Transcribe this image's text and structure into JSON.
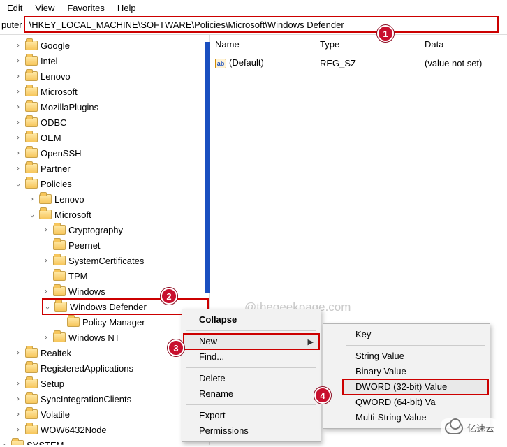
{
  "menu": {
    "edit": "Edit",
    "view": "View",
    "favorites": "Favorites",
    "help": "Help"
  },
  "address": {
    "prefix": "puter",
    "path": "\\HKEY_LOCAL_MACHINE\\SOFTWARE\\Policies\\Microsoft\\Windows Defender"
  },
  "columns": {
    "name": "Name",
    "type": "Type",
    "data": "Data"
  },
  "values": [
    {
      "name": "(Default)",
      "type": "REG_SZ",
      "data": "(value not set)"
    }
  ],
  "tree": {
    "google": "Google",
    "intel": "Intel",
    "lenovo": "Lenovo",
    "microsoft": "Microsoft",
    "mozilla": "MozillaPlugins",
    "odbc": "ODBC",
    "oem": "OEM",
    "openssh": "OpenSSH",
    "partner": "Partner",
    "policies": "Policies",
    "p_lenovo": "Lenovo",
    "p_microsoft": "Microsoft",
    "crypto": "Cryptography",
    "peernet": "Peernet",
    "syscert": "SystemCertificates",
    "tpm": "TPM",
    "windows": "Windows",
    "wdef": "Windows Defender",
    "polmgr": "Policy Manager",
    "winnt": "Windows NT",
    "realtek": "Realtek",
    "regapp": "RegisteredApplications",
    "setup": "Setup",
    "sic": "SyncIntegrationClients",
    "volatile": "Volatile",
    "wow64": "WOW6432Node",
    "system": "SYSTEM"
  },
  "ctx1": {
    "collapse": "Collapse",
    "new": "New",
    "find": "Find...",
    "delete": "Delete",
    "rename": "Rename",
    "export": "Export",
    "perm": "Permissions"
  },
  "ctx2": {
    "key": "Key",
    "string": "String Value",
    "binary": "Binary Value",
    "dword": "DWORD (32-bit) Value",
    "qword": "QWORD (64-bit) Va",
    "multi": "Multi-String Value"
  },
  "badges": {
    "b1": "1",
    "b2": "2",
    "b3": "3",
    "b4": "4"
  },
  "watermark": "@thegeekpage.com",
  "logo_text": "亿速云"
}
